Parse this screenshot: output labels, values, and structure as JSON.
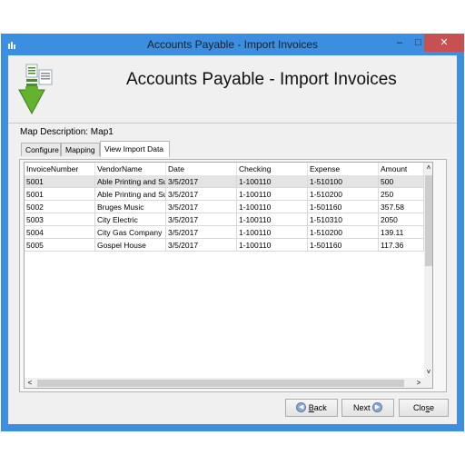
{
  "window": {
    "title": "Accounts Payable - Import Invoices",
    "controls": {
      "minimize": "–",
      "maximize": "□",
      "close": "✕"
    },
    "accent": "#3c8ee0",
    "close_color": "#c75050"
  },
  "header": {
    "icon": "import-document-arrow-icon",
    "title": "Accounts Payable - Import Invoices"
  },
  "map_description": "Map Description: Map1",
  "tabs": [
    {
      "label": "Configure",
      "active": false
    },
    {
      "label": "Mapping",
      "active": false
    },
    {
      "label": "View Import Data",
      "active": true
    }
  ],
  "grid": {
    "columns": [
      "InvoiceNumber",
      "VendorName",
      "Date",
      "Checking",
      "Expense",
      "Amount"
    ],
    "rows": [
      [
        "5001",
        "Able Printing and Su",
        "3/5/2017",
        "1-100110",
        "1-510100",
        "500"
      ],
      [
        "5001",
        "Able Printing and Su",
        "3/5/2017",
        "1-100110",
        "1-510200",
        "250"
      ],
      [
        "5002",
        "Bruges Music",
        "3/5/2017",
        "1-100110",
        "1-501160",
        "357.58"
      ],
      [
        "5003",
        "City Electric",
        "3/5/2017",
        "1-100110",
        "1-510310",
        "2050"
      ],
      [
        "5004",
        "City Gas Company",
        "3/5/2017",
        "1-100110",
        "1-510200",
        "139.11"
      ],
      [
        "5005",
        "Gospel House",
        "3/5/2017",
        "1-100110",
        "1-501160",
        "117.36"
      ]
    ],
    "selected_row": 0
  },
  "scroll": {
    "up": "˄",
    "down": "˅",
    "left": "<",
    "right": ">"
  },
  "buttons": {
    "back": {
      "label_underlined": "B",
      "label_rest": "ack",
      "icon": "back-arrow-icon"
    },
    "next": {
      "label_pre": "Next",
      "icon": "next-arrow-icon"
    },
    "close": {
      "label_pre": "Clo",
      "label_underlined": "s",
      "label_rest": "e"
    }
  }
}
